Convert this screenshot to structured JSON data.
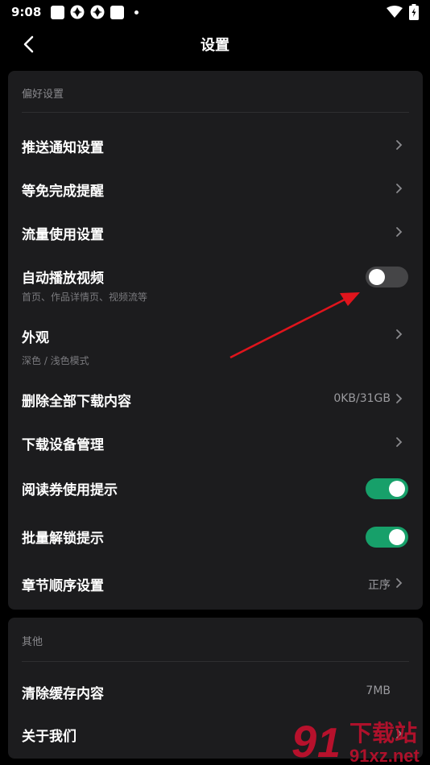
{
  "status": {
    "time": "9:08"
  },
  "header": {
    "title": "设置"
  },
  "preferences": {
    "section_title": "偏好设置",
    "push": {
      "label": "推送通知设置"
    },
    "free_reminder": {
      "label": "等免完成提醒"
    },
    "data_usage": {
      "label": "流量使用设置"
    },
    "autoplay": {
      "label": "自动播放视频",
      "sub": "首页、作品详情页、视频流等",
      "enabled": false
    },
    "appearance": {
      "label": "外观",
      "sub": "深色 / 浅色模式"
    },
    "delete_downloads": {
      "label": "删除全部下载内容",
      "value": "0KB/31GB"
    },
    "download_devices": {
      "label": "下载设备管理"
    },
    "ticket_tip": {
      "label": "阅读券使用提示",
      "enabled": true
    },
    "batch_unlock": {
      "label": "批量解锁提示",
      "enabled": true
    },
    "chapter_order": {
      "label": "章节顺序设置",
      "value": "正序"
    }
  },
  "other": {
    "section_title": "其他",
    "clear_cache": {
      "label": "清除缓存内容",
      "value": "7MB"
    },
    "about": {
      "label": "关于我们"
    }
  },
  "watermark": {
    "text_top": "下载站",
    "text_bottom": "91xz.net"
  },
  "colors": {
    "toggle_on": "#17a06a",
    "toggle_off": "#454547",
    "card": "#1c1c1e",
    "annotation_arrow": "#e0141c"
  }
}
